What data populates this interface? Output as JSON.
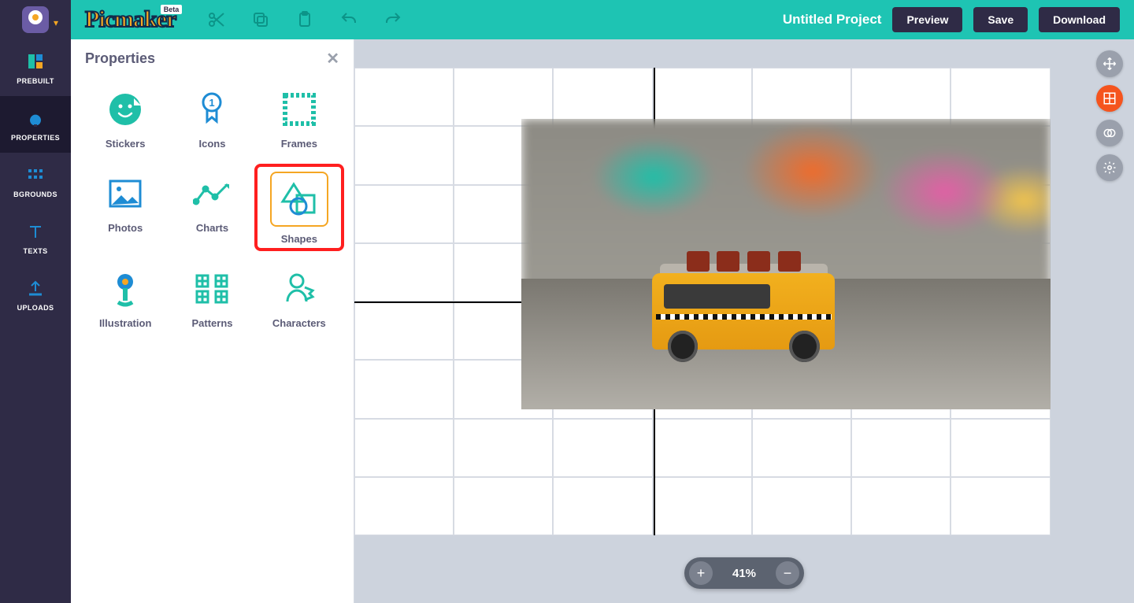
{
  "brand": {
    "name": "Picmaker",
    "badge": "Beta"
  },
  "header": {
    "project_title": "Untitled Project",
    "preview": "Preview",
    "save": "Save",
    "download": "Download"
  },
  "leftrail": {
    "prebuilt": "PREBUILT",
    "properties": "PROPERTIES",
    "bgrounds": "BGROUNDS",
    "texts": "TEXTS",
    "uploads": "UPLOADS"
  },
  "panel": {
    "title": "Properties",
    "categories": {
      "stickers": "Stickers",
      "icons": "Icons",
      "frames": "Frames",
      "photos": "Photos",
      "charts": "Charts",
      "shapes": "Shapes",
      "illustration": "Illustration",
      "patterns": "Patterns",
      "characters": "Characters"
    }
  },
  "zoom": {
    "value": "41%"
  },
  "colors": {
    "header": "#1ec4b3",
    "rail": "#2f2b46",
    "accent_orange": "#f5a623",
    "accent_red": "#ff1f1f",
    "accent_blue": "#1e8cd4"
  }
}
